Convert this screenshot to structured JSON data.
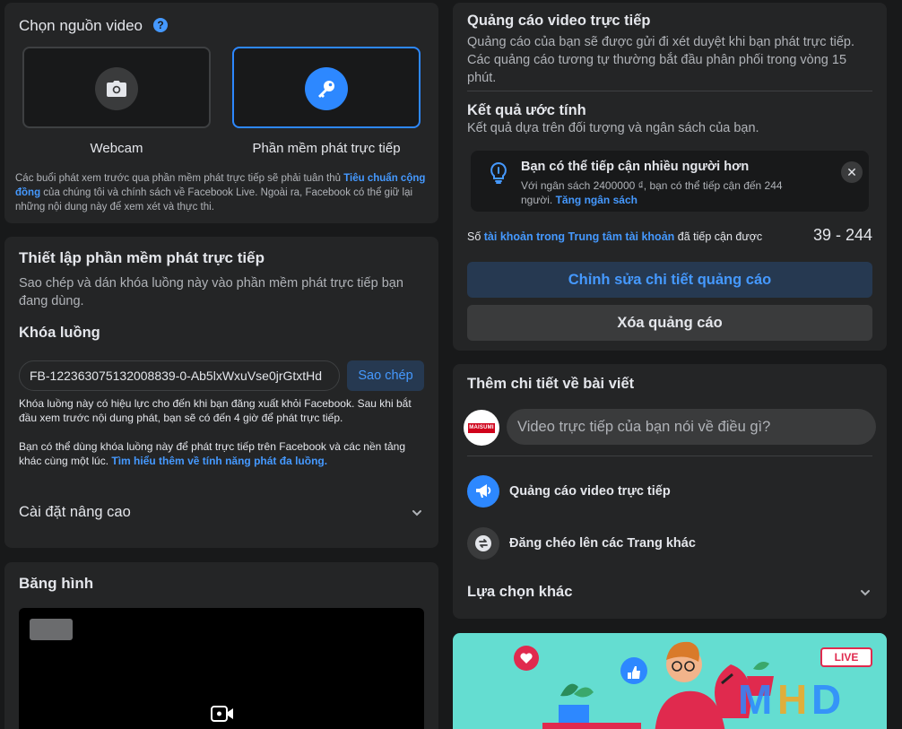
{
  "source": {
    "title": "Chọn nguồn video",
    "options": [
      {
        "label": "Webcam",
        "selected": false
      },
      {
        "label": "Phần mềm phát trực tiếp",
        "selected": true
      }
    ],
    "note_prefix": "Các buổi phát xem trước qua phần mềm phát trực tiếp sẽ phải tuân thủ ",
    "note_link": "Tiêu chuẩn cộng đồng",
    "note_suffix": " của chúng tôi và chính sách về Facebook Live. Ngoài ra, Facebook có thể giữ lại những nội dung này để xem xét và thực thi."
  },
  "setup": {
    "title": "Thiết lập phần mềm phát trực tiếp",
    "description": "Sao chép và dán khóa luồng này vào phần mềm phát trực tiếp bạn đang dùng.",
    "key_title": "Khóa luồng",
    "key_value": "FB-122363075132008839-0-Ab5lxWxuVse0jrGtxtHd",
    "copy_label": "Sao chép",
    "note1": "Khóa luồng này có hiệu lực cho đến khi bạn đăng xuất khỏi Facebook. Sau khi bắt đầu xem trước nội dung phát, bạn sẽ có đến 4 giờ để phát trực tiếp.",
    "note2_prefix": "Bạn có thể dùng khóa luồng này để phát trực tiếp trên Facebook và các nền tảng khác cùng một lúc. ",
    "note2_link": "Tìm hiểu thêm về tính năng phát đa luồng.",
    "advanced_label": "Cài đặt nâng cao"
  },
  "preview": {
    "title": "Băng hình"
  },
  "ad": {
    "title": "Quảng cáo video trực tiếp",
    "description": "Quảng cáo của bạn sẽ được gửi đi xét duyệt khi bạn phát trực tiếp. Các quảng cáo tương tự thường bắt đầu phân phối trong vòng 15 phút.",
    "estimate_title": "Kết quả ước tính",
    "estimate_desc": "Kết quả dựa trên đối tượng và ngân sách của bạn.",
    "tip_title": "Bạn có thể tiếp cận nhiều người hơn",
    "tip_body": "Với ngân sách 2400000 ₫, bạn có thể tiếp cận đến 244 người. ",
    "tip_link": "Tăng ngân sách",
    "reach_prefix": "Số ",
    "reach_link": "tài khoản trong Trung tâm tài khoản",
    "reach_suffix": " đã tiếp cận được",
    "reach_value": "39 - 244",
    "edit_label": "Chỉnh sửa chi tiết quảng cáo",
    "delete_label": "Xóa quảng cáo"
  },
  "post": {
    "title": "Thêm chi tiết về bài viết",
    "avatar_text": "MAISUMI",
    "input_placeholder": "Video trực tiếp của bạn nói về điều gì?",
    "items": [
      {
        "label": "Quảng cáo video trực tiếp",
        "icon": "megaphone-icon"
      },
      {
        "label": "Đăng chéo lên các Trang khác",
        "icon": "crosspost-icon"
      }
    ],
    "more_label": "Lựa chọn khác"
  },
  "illustration": {
    "live_badge": "LIVE"
  },
  "colors": {
    "background": "#18191a",
    "card": "#242526",
    "accent": "#2d88ff",
    "link": "#4599ff",
    "illustration_bg": "#64ddd1"
  }
}
